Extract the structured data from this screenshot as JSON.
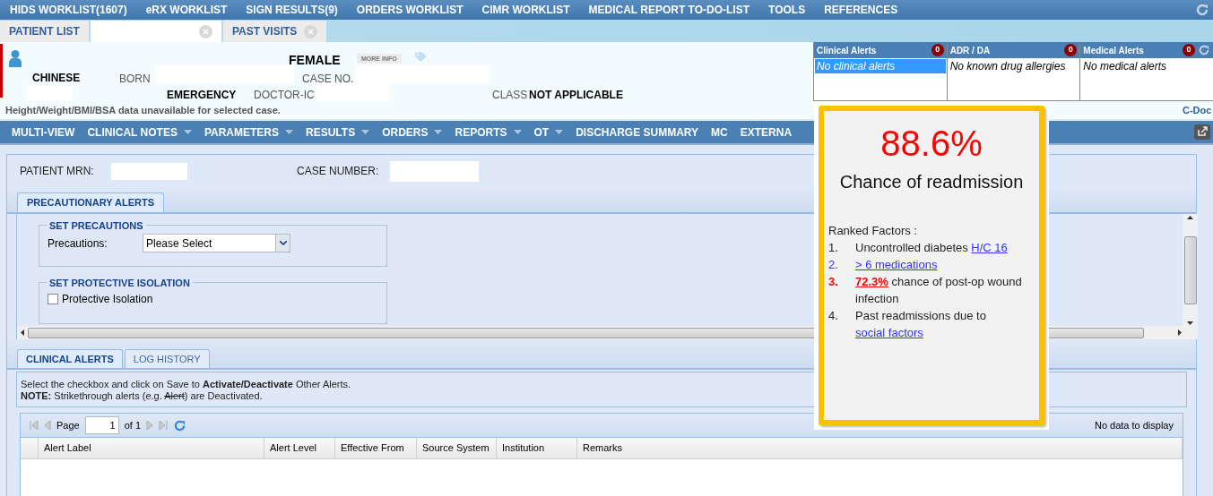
{
  "top_menu": [
    "HIDS WORKLIST(1607)",
    "eRX WORKLIST",
    "SIGN RESULTS(9)",
    "ORDERS WORKLIST",
    "CIMR WORKLIST",
    "MEDICAL REPORT TO-DO-LIST",
    "TOOLS",
    "REFERENCES"
  ],
  "patient_tabs": [
    {
      "label": "PATIENT LIST",
      "selected": false,
      "closable": false
    },
    {
      "selected": true,
      "closable": true
    },
    {
      "label": "PAST VISITS",
      "selected": false,
      "closable": true
    }
  ],
  "patient": {
    "gender": "FEMALE",
    "more_info": "MORE INFO",
    "race": "CHINESE",
    "born_label": "BORN",
    "case_no_label": "CASE NO.",
    "admission_type": "EMERGENCY",
    "doctor_label": "DOCTOR-IC",
    "class_label": "CLASS",
    "class_value": "NOT APPLICABLE",
    "vitals_note": "Height/Weight/BMI/BSA data unavailable for selected case.",
    "cdoc": "C-Doc"
  },
  "alert_panels": [
    {
      "title": "Clinical Alerts",
      "count": "0",
      "text": "No clinical alerts",
      "selected": true
    },
    {
      "title": "ADR / DA",
      "count": "0",
      "text": "No known drug allergies",
      "selected": false
    },
    {
      "title": "Medical Alerts",
      "count": "0",
      "text": "No medical alerts",
      "selected": false
    }
  ],
  "nav_menu": [
    {
      "label": "MULTI-VIEW",
      "dropdown": false
    },
    {
      "label": "CLINICAL NOTES",
      "dropdown": true
    },
    {
      "label": "PARAMETERS",
      "dropdown": true
    },
    {
      "label": "RESULTS",
      "dropdown": true
    },
    {
      "label": "ORDERS",
      "dropdown": true
    },
    {
      "label": "REPORTS",
      "dropdown": true
    },
    {
      "label": "OT",
      "dropdown": true
    },
    {
      "label": "DISCHARGE SUMMARY",
      "dropdown": false
    },
    {
      "label": "MC",
      "dropdown": false
    },
    {
      "label": "EXTERNA",
      "dropdown": false
    }
  ],
  "search": {
    "mrn_label": "PATIENT MRN:",
    "case_label": "CASE NUMBER:"
  },
  "upper_tabs": [
    {
      "label": "PRECAUTIONARY ALERTS",
      "selected": true
    }
  ],
  "precautions": {
    "legend": "SET PRECAUTIONS",
    "label": "Precautions:",
    "value": "Please Select"
  },
  "isolation": {
    "legend": "SET PROTECTIVE ISOLATION",
    "label": "Protective Isolation",
    "checked": false
  },
  "lower_tabs": [
    {
      "label": "CLINICAL ALERTS",
      "selected": true
    },
    {
      "label": "LOG HISTORY",
      "selected": false
    }
  ],
  "instructions": {
    "line1": "Select the checkbox and click on Save to **Activate/Deactivate** Other Alerts.",
    "line2_before": "**NOTE:** Strikethrough alerts (e.g. ",
    "line2_struck": "Alert",
    "line2_after": ") are Deactivated."
  },
  "pager": {
    "page_label": "Page",
    "page": "1",
    "of": "of 1",
    "status": "No data to display"
  },
  "table": {
    "columns": [
      "Alert Label",
      "Alert Level",
      "Effective From",
      "Source System",
      "Institution",
      "Remarks"
    ]
  },
  "readmission": {
    "score": "88.6%",
    "caption": "Chance of readmission",
    "factors_title": "Ranked Factors :",
    "factors": [
      {
        "number": "1.",
        "kind": "plain",
        "segments": [
          {
            "text": "Uncontrolled diabetes ",
            "link": false
          },
          {
            "text": "H/C 16",
            "link": true
          }
        ]
      },
      {
        "number": "2.",
        "kind": "link",
        "segments": [
          {
            "text": "> 6 medications",
            "link": true
          }
        ]
      },
      {
        "number": "3.",
        "kind": "alert",
        "segments": [
          {
            "text": "72.3%",
            "link": true
          },
          {
            "text": " chance of post-op wound infection",
            "link": false
          }
        ]
      },
      {
        "number": "4.",
        "kind": "plain",
        "segments": [
          {
            "text": "Past readmissions due to ",
            "link": false
          },
          {
            "text": "social factors",
            "link": true
          }
        ]
      }
    ]
  }
}
